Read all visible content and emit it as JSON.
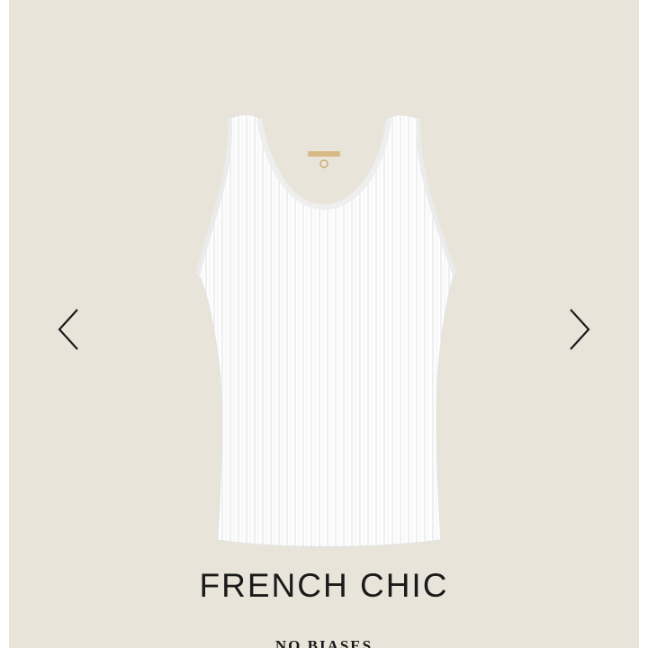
{
  "carousel": {
    "prev_icon": "chevron-left-icon",
    "next_icon": "chevron-right-icon",
    "image_alt": "white ribbed tank top",
    "background_color": "#e9e4da"
  },
  "product": {
    "title": "FRENCH CHIC",
    "subtitle": "NO BIASES"
  }
}
